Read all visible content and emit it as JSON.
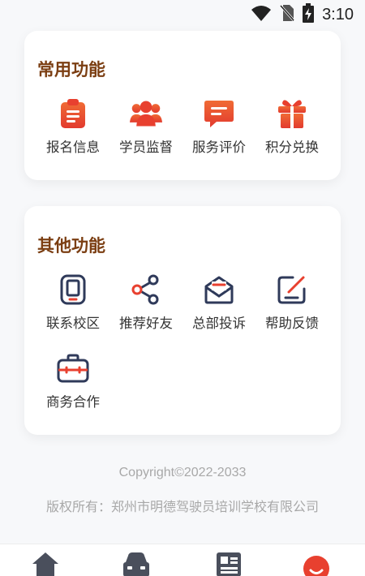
{
  "status_bar": {
    "time": "3:10",
    "icons": [
      "wifi-icon",
      "no-sim-icon",
      "battery-charging-icon"
    ]
  },
  "common": {
    "title": "常用功能",
    "items": [
      {
        "label": "报名信息",
        "icon": "clipboard-icon"
      },
      {
        "label": "学员监督",
        "icon": "users-icon"
      },
      {
        "label": "服务评价",
        "icon": "message-icon"
      },
      {
        "label": "积分兑换",
        "icon": "gift-icon"
      }
    ]
  },
  "other": {
    "title": "其他功能",
    "items": [
      {
        "label": "联系校区",
        "icon": "phone-icon"
      },
      {
        "label": "推荐好友",
        "icon": "share-icon"
      },
      {
        "label": "总部投诉",
        "icon": "mail-icon"
      },
      {
        "label": "帮助反馈",
        "icon": "edit-icon"
      },
      {
        "label": "商务合作",
        "icon": "briefcase-icon"
      }
    ]
  },
  "footer": {
    "copyright": "Copyright©2022-2033",
    "owner": "版权所有：郑州市明德驾驶员培训学校有限公司"
  },
  "tabbar": {
    "icons": [
      "home-icon",
      "car-icon",
      "news-icon",
      "profile-icon"
    ]
  },
  "colors": {
    "accent_red": "#e8402f",
    "icon_navy": "#2f3a5a",
    "title_brown": "#7b3e12"
  }
}
